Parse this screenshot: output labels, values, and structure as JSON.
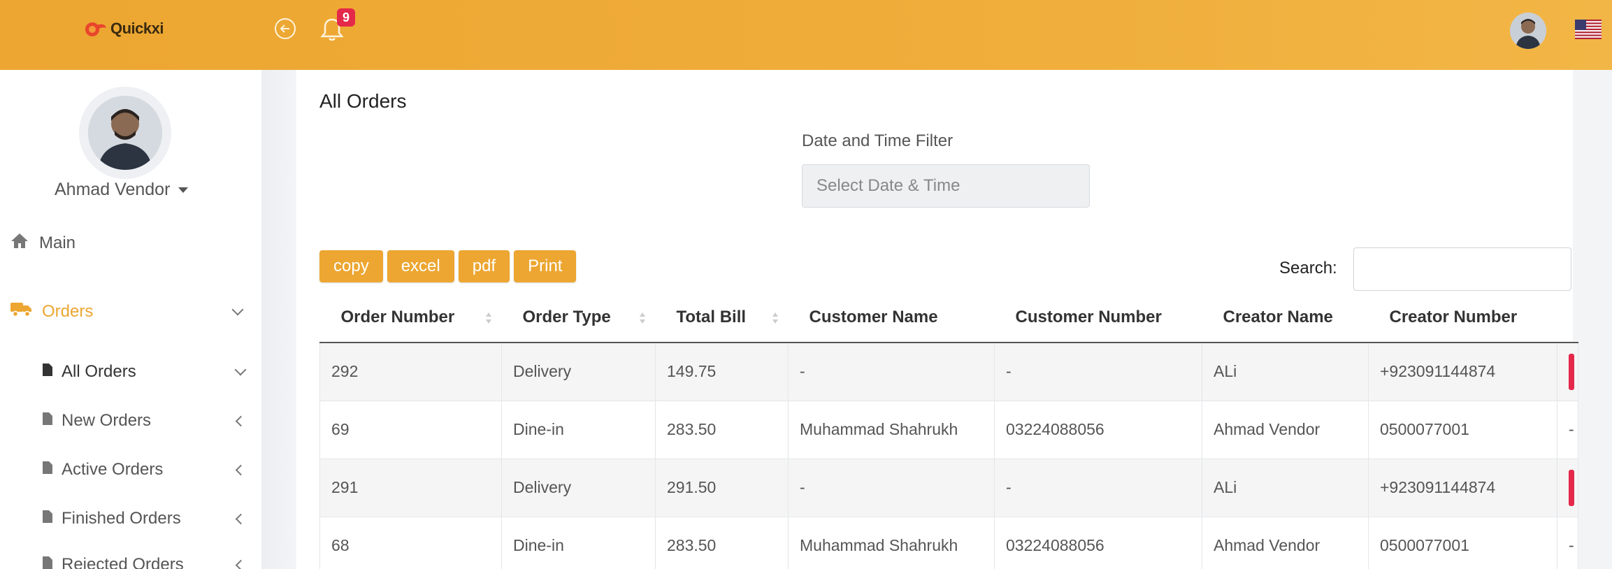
{
  "app": {
    "name": "Quickxi",
    "notification_count": "9"
  },
  "user": {
    "name": "Ahmad Vendor"
  },
  "sidebar": {
    "main_label": "Main",
    "orders_label": "Orders",
    "sub_items": [
      {
        "label": "All Orders"
      },
      {
        "label": "New Orders"
      },
      {
        "label": "Active Orders"
      },
      {
        "label": "Finished Orders"
      },
      {
        "label": "Rejected Orders"
      }
    ]
  },
  "page": {
    "title": "All Orders",
    "filter_label": "Date and Time Filter",
    "filter_placeholder": "Select Date & Time",
    "search_label": "Search:"
  },
  "export_buttons": {
    "copy": "copy",
    "excel": "excel",
    "pdf": "pdf",
    "print": "Print"
  },
  "table": {
    "columns": [
      "Order Number",
      "Order Type",
      "Total Bill",
      "Customer Name",
      "Customer Number",
      "Creator Name",
      "Creator Number"
    ],
    "rows": [
      [
        "292",
        "Delivery",
        "149.75",
        "-",
        "-",
        "ALi",
        "+923091144874"
      ],
      [
        "69",
        "Dine-in",
        "283.50",
        "Muhammad Shahrukh",
        "03224088056",
        "Ahmad Vendor",
        "0500077001"
      ],
      [
        "291",
        "Delivery",
        "291.50",
        "-",
        "-",
        "ALi",
        "+923091144874"
      ],
      [
        "68",
        "Dine-in",
        "283.50",
        "Muhammad Shahrukh",
        "03224088056",
        "Ahmad Vendor",
        "0500077001"
      ]
    ],
    "trailing_cells": [
      "",
      "-",
      "",
      "-"
    ]
  },
  "colors": {
    "accent": "#eca631",
    "badge": "#e4284a"
  }
}
